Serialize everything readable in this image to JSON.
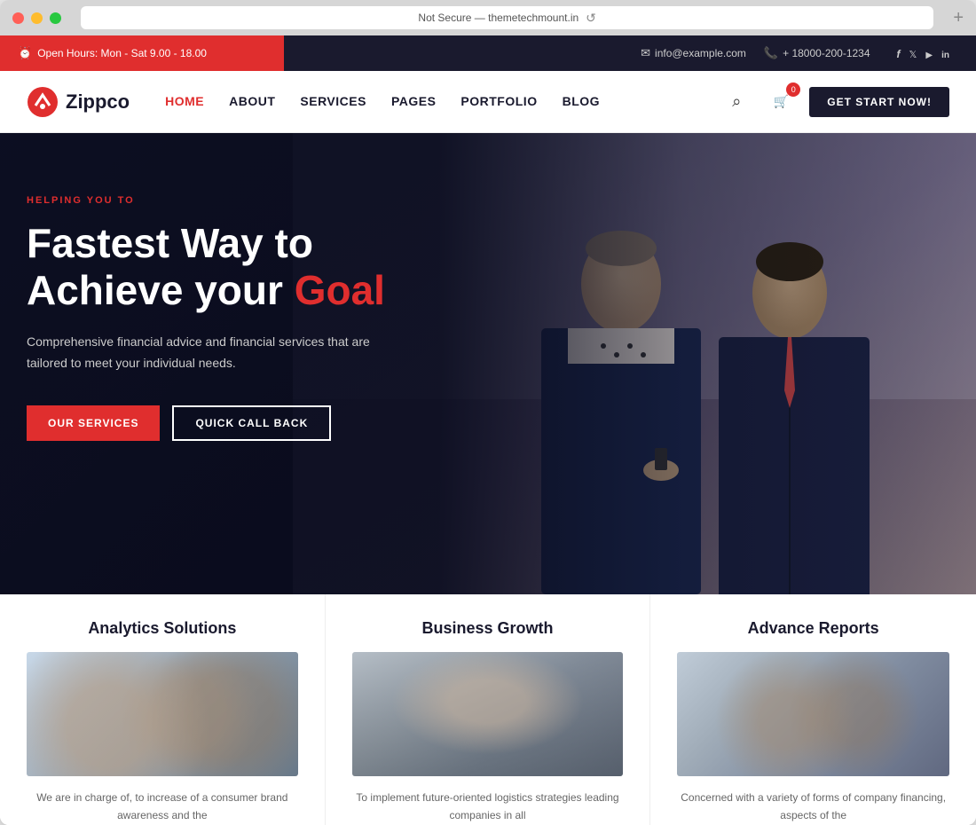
{
  "browser": {
    "address": "Not Secure — themetechmount.in",
    "reload_title": "Reload"
  },
  "topbar": {
    "open_hours_icon": "clock",
    "open_hours": "Open Hours: Mon - Sat 9.00 - 18.00",
    "email_icon": "mail",
    "email": "info@example.com",
    "phone_icon": "phone",
    "phone": "+ 18000-200-1234",
    "social": [
      "f",
      "𝕏",
      "▶",
      "in"
    ]
  },
  "nav": {
    "logo_text": "Zippco",
    "links": [
      {
        "label": "HOME",
        "active": true
      },
      {
        "label": "ABOUT",
        "active": false
      },
      {
        "label": "SERVICES",
        "active": false
      },
      {
        "label": "PAGES",
        "active": false
      },
      {
        "label": "PORTFOLIO",
        "active": false
      },
      {
        "label": "BLOG",
        "active": false
      }
    ],
    "cart_count": "0",
    "cta_label": "GET START NOW!"
  },
  "hero": {
    "subtitle": "HELPING YOU TO",
    "title_part1": "Fastest Way to",
    "title_part2": "Achieve your ",
    "title_highlight": "Goal",
    "description": "Comprehensive financial advice and financial services that are tailored to meet your individual needs.",
    "btn_primary": "OUR SERVICES",
    "btn_secondary": "QUICK CALL BACK"
  },
  "services": [
    {
      "title": "Analytics Solutions",
      "description": "We are in charge of, to increase of a consumer brand awareness and the"
    },
    {
      "title": "Business Growth",
      "description": "To implement future-oriented logistics strategies leading companies in all"
    },
    {
      "title": "Advance Reports",
      "description": "Concerned with a variety of forms of company financing, aspects of the"
    }
  ]
}
